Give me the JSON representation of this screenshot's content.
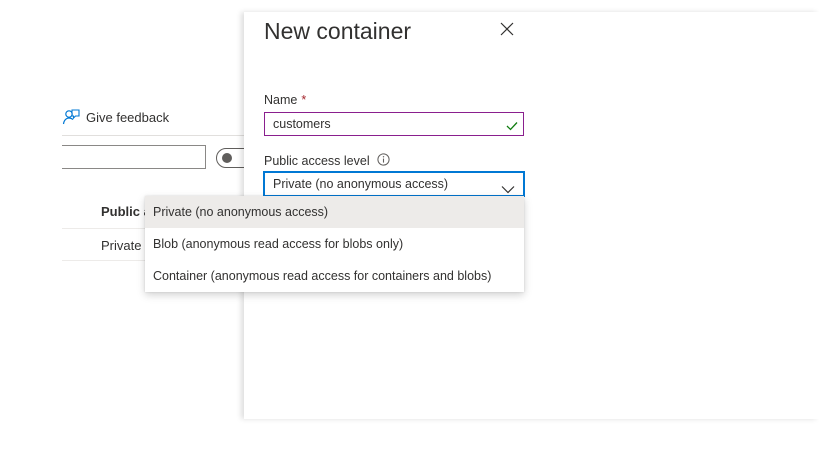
{
  "background_page": {
    "feedback_label": "Give feedback",
    "column_header": "Public a",
    "row_value": "Private"
  },
  "panel": {
    "title": "New container",
    "name_field": {
      "label": "Name",
      "required_marker": "*",
      "value": "customers",
      "valid": true
    },
    "access_field": {
      "label": "Public access level",
      "selected": "Private (no anonymous access)",
      "options": [
        "Private (no anonymous access)",
        "Blob (anonymous read access for blobs only)",
        "Container (anonymous read access for containers and blobs)"
      ],
      "highlighted_index": 0,
      "expanded": true
    }
  },
  "colors": {
    "focus_border": "#0078d4",
    "name_border": "#8a1f8e",
    "valid_check": "#107c10",
    "required": "#a4262c",
    "feedback_icon": "#0078d4",
    "selected_option_bg": "#edebe9"
  },
  "icons": {
    "feedback": "feedback-person-icon",
    "close": "close-icon",
    "info": "info-icon",
    "valid": "checkmark-icon",
    "dropdown": "chevron-down-icon"
  }
}
